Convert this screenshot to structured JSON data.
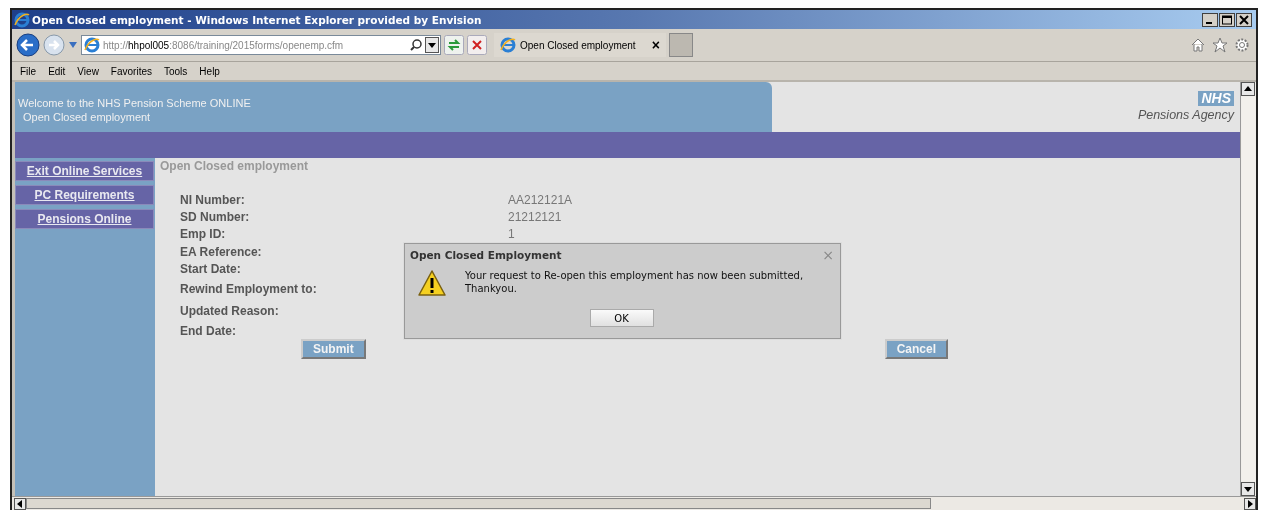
{
  "window": {
    "title": "Open Closed employment - Windows Internet Explorer provided by Envision"
  },
  "browser": {
    "address": "http://**hhpol005**:8086/training/2015forms/openemp.cfm",
    "tab": {
      "label": "Open Closed employment",
      "close": "×"
    },
    "menu": [
      "File",
      "Edit",
      "View",
      "Favorites",
      "Tools",
      "Help"
    ]
  },
  "header": {
    "welcome": "Welcome to the NHS Pension Scheme ONLINE",
    "subtitle": "Open Closed employment",
    "logo": "NHS",
    "agency": "Pensions Agency"
  },
  "sidebar": {
    "items": [
      "Exit Online Services",
      "PC Requirements",
      "Pensions Online"
    ]
  },
  "form": {
    "title": "Open Closed employment",
    "fields": [
      {
        "label": "NI Number:",
        "value": "AA212121A"
      },
      {
        "label": "SD Number:",
        "value": "21212121"
      },
      {
        "label": "Emp ID:",
        "value": "1"
      },
      {
        "label": "EA Reference:"
      },
      {
        "label": "Start Date:"
      },
      {
        "label": "Rewind Employment to:",
        "kind": "tall"
      },
      {
        "label": "Updated Reason:",
        "kind": "tall"
      },
      {
        "label": "End Date:"
      }
    ],
    "buttons": [
      "Submit",
      "Cancel"
    ]
  },
  "dialog": {
    "title": "Open Closed Employment",
    "close": "×",
    "message_lines": [
      "Your request to Re-open this employment has now been submitted,",
      "Thankyou."
    ],
    "button": "OK"
  }
}
